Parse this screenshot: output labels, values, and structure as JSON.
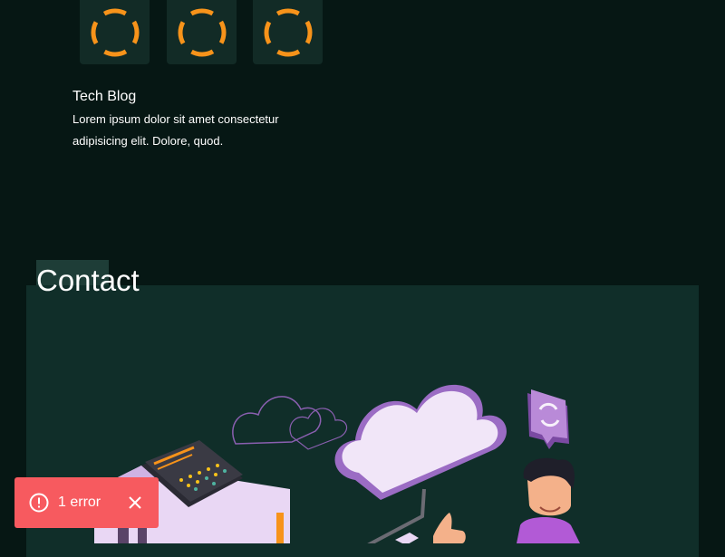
{
  "loaders": [
    {
      "icon": "spinner-icon",
      "color": "#f7931a"
    },
    {
      "icon": "spinner-icon",
      "color": "#f7931a"
    },
    {
      "icon": "spinner-icon",
      "color": "#f7931a"
    }
  ],
  "blog": {
    "title": "Tech Blog",
    "description": "Lorem ipsum dolor sit amet consectetur adipisicing elit. Dolore, quod."
  },
  "contact": {
    "heading": "Contact",
    "illustration": "cloud-computing-illustration"
  },
  "error_toast": {
    "icon": "alert-circle-icon",
    "text": "1 error",
    "close_icon": "close-icon",
    "color": "#f75a5f"
  },
  "colors": {
    "background": "#061714",
    "panel": "#102e29",
    "accent": "#f7931a",
    "purple": "#b98ad8"
  }
}
